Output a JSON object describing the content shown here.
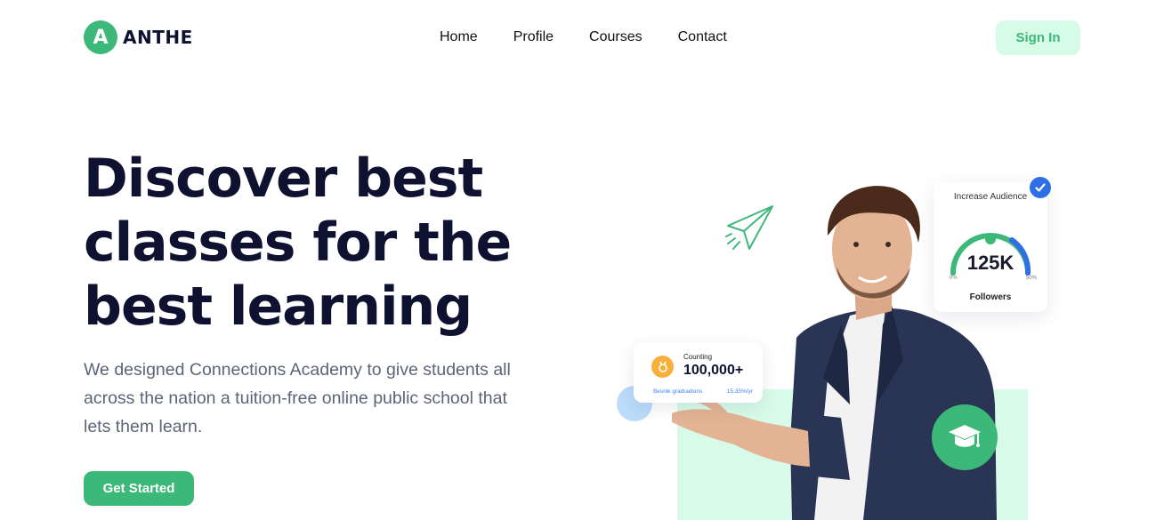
{
  "brand": {
    "mark": "A",
    "name": "ANTHE",
    "accent": "#3cb878"
  },
  "nav": {
    "items": [
      "Home",
      "Profile",
      "Courses",
      "Contact"
    ]
  },
  "header": {
    "signin_label": "Sign In"
  },
  "hero": {
    "title_line1": "Discover best",
    "title_line2": "classes for the",
    "title_line3": "best learning",
    "description": "We designed Connections Academy to give students all across the nation a tuition-free online public school that lets them learn.",
    "cta_label": "Get Started"
  },
  "counting_card": {
    "label": "Counting",
    "value": "100,000+",
    "footer_left": "Besnik graduations",
    "footer_right": "15.35%/yr",
    "icon": "medal-icon"
  },
  "audience_card": {
    "title": "Increase Audience",
    "value": "125K",
    "min_label": "0%",
    "max_label": "50%",
    "footer": "Followers",
    "icon": "check-icon"
  },
  "decor": {
    "plane_icon": "paper-plane-icon",
    "cap_icon": "graduation-cap-icon"
  }
}
